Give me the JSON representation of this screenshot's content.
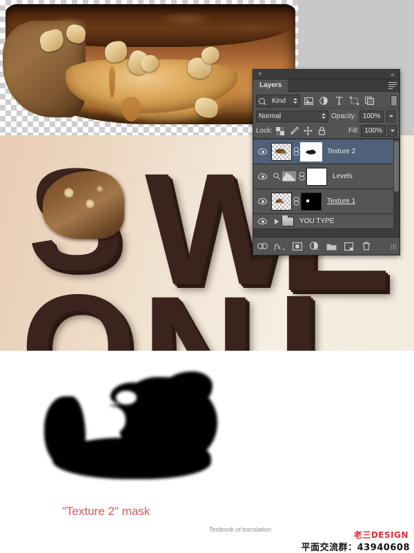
{
  "panel": {
    "title": "Layers",
    "close_icon": "×",
    "collapse_icon": "«",
    "menu_icon": "panel-menu-icon",
    "filter": {
      "kind_label": "Kind",
      "search_icon": "search-icon",
      "icons": [
        "pixel-filter-icon",
        "adjustment-filter-icon",
        "type-filter-icon",
        "shape-filter-icon",
        "smartobject-filter-icon"
      ],
      "toggle": "filter-toggle"
    },
    "blend": {
      "mode": "Normal",
      "opacity_label": "Opacity:",
      "opacity_value": "100%"
    },
    "lock": {
      "label": "Lock:",
      "icons": [
        "lock-transparent-pixels-icon",
        "lock-image-pixels-icon",
        "lock-position-icon",
        "lock-all-icon"
      ],
      "fill_label": "Fill:",
      "fill_value": "100%"
    },
    "layers": [
      {
        "name": "Texture 2",
        "visible": true,
        "selected": true,
        "type": "pixel",
        "thumb": "checker",
        "mask": "white",
        "mask_selected": true,
        "linked": true,
        "editing": false
      },
      {
        "name": "Levels",
        "visible": true,
        "selected": false,
        "type": "adjustment",
        "thumb": "levels-histogram-icon",
        "mask": "white",
        "mask_selected": false,
        "linked": true,
        "editing": false
      },
      {
        "name": "Texture 1",
        "visible": true,
        "selected": false,
        "type": "pixel",
        "thumb": "checker",
        "mask": "black",
        "mask_selected": false,
        "linked": true,
        "editing": true
      },
      {
        "name": "YOU TYPE",
        "visible": true,
        "selected": false,
        "type": "group",
        "thumb": "folder-icon",
        "expanded": false
      }
    ],
    "footer_icons": [
      "link-layers-icon",
      "layer-style-fx-icon",
      "add-layer-mask-icon",
      "new-adjustment-layer-icon",
      "new-group-icon",
      "new-layer-icon",
      "delete-layer-icon"
    ]
  },
  "captions": {
    "mask_caption": "\"Texture 2\" mask",
    "textbook": "Textbook of translation"
  },
  "watermark": {
    "logo": "老三DESIGN",
    "qq": "平面交流群：43940608"
  },
  "artwork": {
    "letters": [
      "S",
      "W",
      "E",
      "O",
      "N",
      "L"
    ],
    "top_section": "chocolate-bar-cutout-on-transparency",
    "mask_section": "black-mask-blob-on-white"
  },
  "colors": {
    "panel_bg": "#535353",
    "list_bg": "#555555",
    "selected_row": "#4f6079",
    "caption_red": "#d4575e",
    "logo_red": "#e8282f",
    "letter_brown": "#3b241d",
    "checker_gray": "#c8c8c8"
  }
}
